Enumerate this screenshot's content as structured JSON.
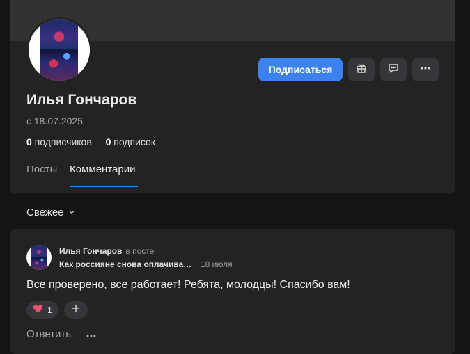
{
  "profile": {
    "name": "Илья Гончаров",
    "since": "с 18.07.2025",
    "followers_count": "0",
    "followers_label": "подписчиков",
    "following_count": "0",
    "following_label": "подписок",
    "subscribe_label": "Подписаться",
    "icons": [
      "gift-icon",
      "message-icon",
      "more-icon"
    ]
  },
  "tabs": [
    {
      "label": "Посты",
      "active": false
    },
    {
      "label": "Комментарии",
      "active": true
    }
  ],
  "sort": {
    "label": "Свежее"
  },
  "comment": {
    "author": "Илья Гончаров",
    "context": "в посте",
    "post_title": "Как россияне снова оплачива…",
    "date": "18 июля",
    "text": "Все проверено, все работает! Ребята, молодцы! Спасибо вам!",
    "reaction_count": "1",
    "reply_label": "Ответить"
  },
  "colors": {
    "accent": "#3c82ee",
    "background": "#141414",
    "card": "#232324",
    "reaction": "#f5506e"
  }
}
